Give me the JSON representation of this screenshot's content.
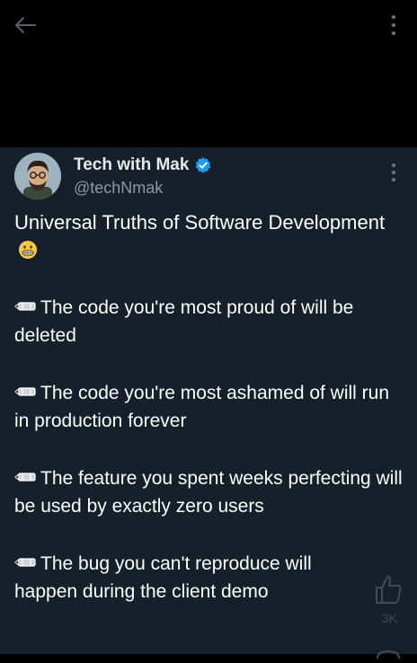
{
  "header": {
    "back_icon": "arrow-left-icon",
    "menu_icon": "more-vertical-icon"
  },
  "post": {
    "author": {
      "display_name": "Tech with Mak",
      "handle": "@techNmak",
      "verified": true,
      "avatar_icon": "cartoon-avatar"
    },
    "title": "Universal Truths of Software Development",
    "title_emoji": "grinning-face-emoji",
    "bullet_icon": "pencil-emoji",
    "truths": [
      "The code you're most proud of will be deleted",
      "The code you're most ashamed of will run in production forever",
      "The feature you spent weeks perfecting will be used by exactly zero users",
      "The bug you can't reproduce will happen during the client demo"
    ],
    "actions": {
      "like_icon": "thumbs-up-icon",
      "like_count": "3K"
    }
  },
  "colors": {
    "page_background": "#000000",
    "post_background": "#15202b",
    "text_primary": "#ffffff",
    "text_secondary": "#8b98a5",
    "verified_blue": "#1d9bf0"
  }
}
